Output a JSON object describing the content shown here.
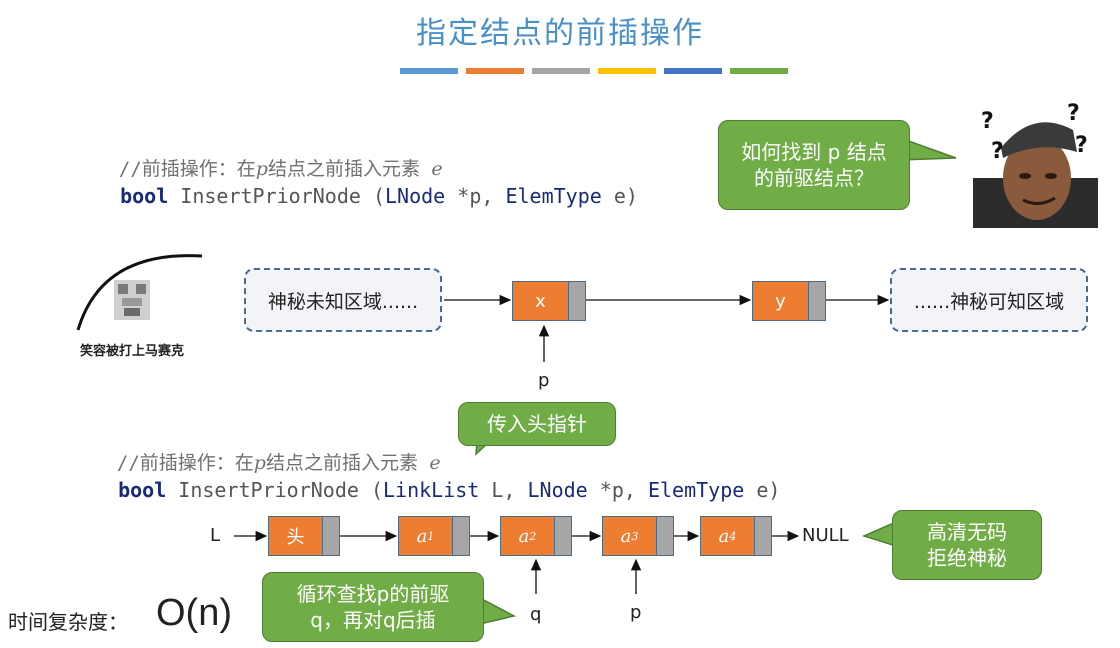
{
  "title": "指定结点的前插操作",
  "stripe_colors": [
    "#5b9bd5",
    "#ed7d31",
    "#a5a5a5",
    "#ffc000",
    "#4472c4",
    "#70ad47"
  ],
  "code1": {
    "comment_prefix": "//前插操作：在",
    "comment_p": "p",
    "comment_mid": "结点之前插入元素 ",
    "comment_e": "e",
    "kw": "bool",
    "fn": " InsertPriorNode (",
    "t1": "LNode",
    "a1": " *p, ",
    "t2": "ElemType",
    "a2": " e)"
  },
  "code2": {
    "comment_prefix": "//前插操作：在",
    "comment_p": "p",
    "comment_mid": "结点之前插入元素 ",
    "comment_e": "e",
    "kw": "bool",
    "fn": " InsertPriorNode (",
    "t0": "LinkList",
    "a0": " L, ",
    "t1": "LNode",
    "a1": " *p, ",
    "t2": "ElemType",
    "a2": " e)"
  },
  "bubble_top": "如何找到 p 结点的前驱结点？",
  "meme_caption": "笑容被打上马赛克",
  "row1": {
    "left_box": "神秘未知区域......",
    "right_box": "......神秘可知区域",
    "node_x": "x",
    "node_y": "y",
    "pointer_p": "p"
  },
  "bubble_head_ptr": "传入头指针",
  "row2": {
    "L_label": "L",
    "head_node": "头",
    "nodes": [
      "a",
      "a",
      "a",
      "a"
    ],
    "subs": [
      "1",
      "2",
      "3",
      "4"
    ],
    "null_label": "NULL",
    "pointer_q": "q",
    "pointer_p": "p"
  },
  "bubble_hd": "高清无码\n拒绝神秘",
  "bubble_loop": "循环查找p的前驱\nq，再对q后插",
  "complexity_label": "时间复杂度：",
  "complexity_value": "O(n)"
}
